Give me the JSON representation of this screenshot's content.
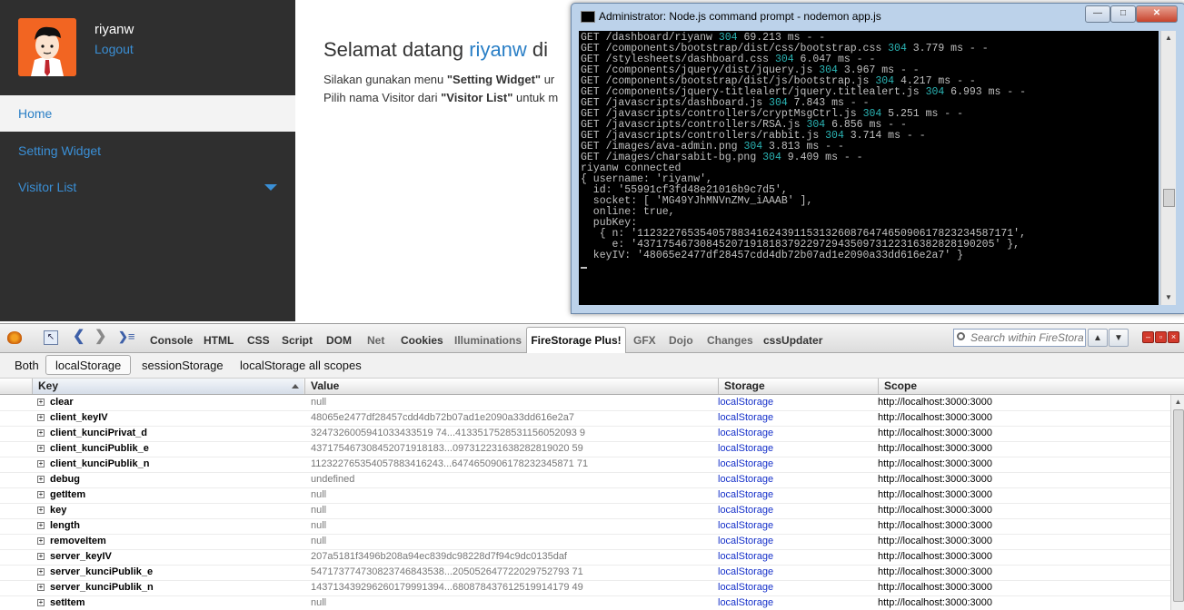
{
  "app": {
    "username": "riyanw",
    "logout": "Logout",
    "nav": {
      "home": "Home",
      "setting_widget": "Setting Widget",
      "visitor_list": "Visitor List"
    },
    "welcome_prefix": "Selamat datang ",
    "welcome_user": "riyanw",
    "welcome_suffix": " di",
    "intro1_a": "Silakan gunakan menu ",
    "intro1_b": "\"Setting Widget\"",
    "intro1_c": " ur",
    "intro2_a": "Pilih nama Visitor dari ",
    "intro2_b": "\"Visitor List\"",
    "intro2_c": " untuk m"
  },
  "cmd": {
    "title": "Administrator: Node.js command prompt - nodemon  app.js",
    "buttons": {
      "min": "—",
      "max": "□",
      "close": "✕"
    },
    "requests": [
      {
        "path": "GET /dashboard/riyanw ",
        "status": "304",
        "time": " 69.213 ms - -"
      },
      {
        "path": "GET /components/bootstrap/dist/css/bootstrap.css ",
        "status": "304",
        "time": " 3.779 ms - -"
      },
      {
        "path": "GET /stylesheets/dashboard.css ",
        "status": "304",
        "time": " 6.047 ms - -"
      },
      {
        "path": "GET /components/jquery/dist/jquery.js ",
        "status": "304",
        "time": " 3.967 ms - -"
      },
      {
        "path": "GET /components/bootstrap/dist/js/bootstrap.js ",
        "status": "304",
        "time": " 4.217 ms - -"
      },
      {
        "path": "GET /components/jquery-titlealert/jquery.titlealert.js ",
        "status": "304",
        "time": " 6.993 ms - -"
      },
      {
        "path": "GET /javascripts/dashboard.js ",
        "status": "304",
        "time": " 7.843 ms - -"
      },
      {
        "path": "GET /javascripts/controllers/cryptMsgCtrl.js ",
        "status": "304",
        "time": " 5.251 ms - -"
      },
      {
        "path": "GET /javascripts/controllers/RSA.js ",
        "status": "304",
        "time": " 6.856 ms - -"
      },
      {
        "path": "GET /javascripts/controllers/rabbit.js ",
        "status": "304",
        "time": " 3.714 ms - -"
      },
      {
        "path": "GET /images/ava-admin.png ",
        "status": "304",
        "time": " 3.813 ms - -"
      },
      {
        "path": "GET /images/charsabit-bg.png ",
        "status": "304",
        "time": " 9.409 ms - -"
      }
    ],
    "tail": [
      "riyanw connected",
      "{ username: 'riyanw',",
      "  id: '55991cf3fd48e21016b9c7d5',",
      "  socket: [ 'MG49YJhMNVnZMv_iAAAB' ],",
      "  online: true,",
      "  pubKey:",
      "   { n: '112322765354057883416243911531326087647465090617823234587171',",
      "     e: '437175467308452071918183792297294350973122316382828190205' },",
      "  keyIV: '48065e2477df28457cdd4db72b07ad1e2090a33dd616e2a7' }"
    ]
  },
  "firebug": {
    "tabs": [
      "Console",
      "HTML",
      "CSS",
      "Script",
      "DOM",
      "Net",
      "Cookies",
      "Illuminations",
      "FireStorage Plus!",
      "GFX",
      "Dojo",
      "Changes",
      "cssUpdater"
    ],
    "search_placeholder": "Search within FireStora",
    "storage_options": [
      "Both",
      "localStorage",
      "sessionStorage",
      "localStorage all scopes"
    ],
    "columns": {
      "key": "Key",
      "value": "Value",
      "storage": "Storage",
      "scope": "Scope"
    },
    "rows": [
      {
        "key": "clear",
        "value": "null",
        "storage": "localStorage",
        "scope": "http://localhost:3000:3000"
      },
      {
        "key": "client_keyIV",
        "value": "48065e2477df28457cdd4db72b07ad1e2090a33dd616e2a7",
        "storage": "localStorage",
        "scope": "http://localhost:3000:3000"
      },
      {
        "key": "client_kunciPrivat_d",
        "value": "3247326005941033433519 74...4133517528531156052093 9",
        "storage": "localStorage",
        "scope": "http://localhost:3000:3000"
      },
      {
        "key": "client_kunciPublik_e",
        "value": "437175467308452071918183...097312231638282819020 59",
        "storage": "localStorage",
        "scope": "http://localhost:3000:3000"
      },
      {
        "key": "client_kunciPublik_n",
        "value": "112322765354057883416243...6474650906178232345871 71",
        "storage": "localStorage",
        "scope": "http://localhost:3000:3000"
      },
      {
        "key": "debug",
        "value": "undefined",
        "storage": "localStorage",
        "scope": "http://localhost:3000:3000"
      },
      {
        "key": "getItem",
        "value": "null",
        "storage": "localStorage",
        "scope": "http://localhost:3000:3000"
      },
      {
        "key": "key",
        "value": "null",
        "storage": "localStorage",
        "scope": "http://localhost:3000:3000"
      },
      {
        "key": "length",
        "value": "null",
        "storage": "localStorage",
        "scope": "http://localhost:3000:3000"
      },
      {
        "key": "removeItem",
        "value": "null",
        "storage": "localStorage",
        "scope": "http://localhost:3000:3000"
      },
      {
        "key": "server_keyIV",
        "value": "207a5181f3496b208a94ec839dc98228d7f94c9dc0135daf",
        "storage": "localStorage",
        "scope": "http://localhost:3000:3000"
      },
      {
        "key": "server_kunciPublik_e",
        "value": "547173774730823746843538...205052647722029752793 71",
        "storage": "localStorage",
        "scope": "http://localhost:3000:3000"
      },
      {
        "key": "server_kunciPublik_n",
        "value": "143713439296260179991394...680878437612519914179 49",
        "storage": "localStorage",
        "scope": "http://localhost:3000:3000"
      },
      {
        "key": "setItem",
        "value": "null",
        "storage": "localStorage",
        "scope": "http://localhost:3000:3000"
      }
    ]
  }
}
